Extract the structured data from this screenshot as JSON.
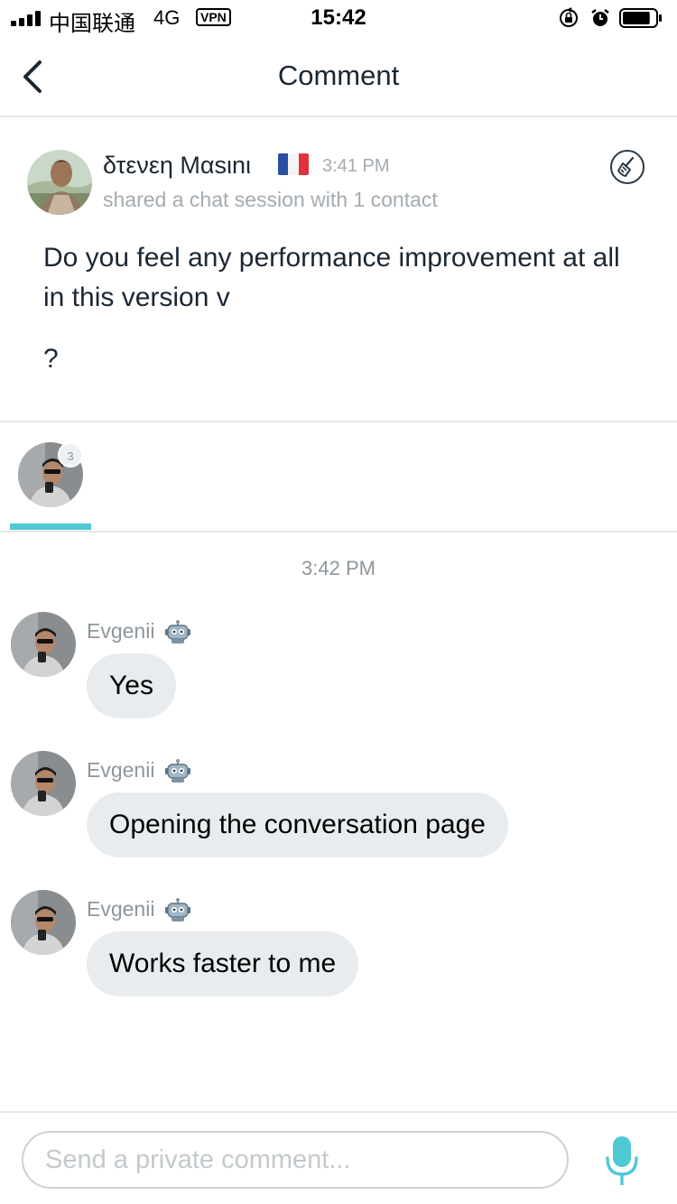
{
  "status_bar": {
    "carrier": "中国联通",
    "network": "4G",
    "vpn": "VPN",
    "time": "15:42",
    "signal_bars": 4,
    "battery_level": 0.85
  },
  "nav": {
    "title": "Comment"
  },
  "post": {
    "author": "δτενεη Μαsιnι",
    "time": "3:41 PM",
    "action": "shared a chat session with 1 contact",
    "body": "Do you feel any performance improvement at all in this version v",
    "body_tail": "?"
  },
  "participants": {
    "badge_count": "3"
  },
  "chat": {
    "timestamp": "3:42 PM",
    "messages": [
      {
        "sender": "Evgenii",
        "text": "Yes"
      },
      {
        "sender": "Evgenii",
        "text": "Opening the conversation page"
      },
      {
        "sender": "Evgenii",
        "text": "Works faster to me"
      }
    ]
  },
  "composer": {
    "placeholder": "Send a private comment...",
    "value": ""
  },
  "colors": {
    "accent": "#4fc9d4",
    "text_primary": "#1b2733",
    "text_secondary": "#8d969c",
    "bubble": "#e8ecee",
    "divider": "#e5e8ea"
  },
  "icons": {
    "back": "chevron-left-icon",
    "clean": "broom-icon",
    "bot": "robot-icon",
    "mic": "microphone-icon"
  }
}
